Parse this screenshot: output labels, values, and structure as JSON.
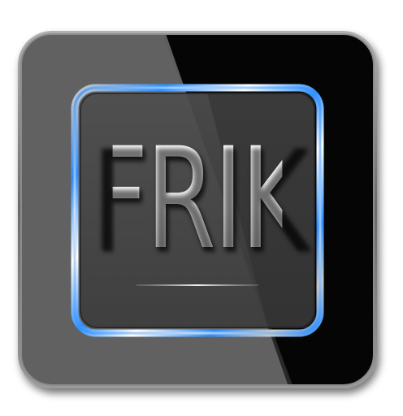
{
  "logo": {
    "text": "FRIK",
    "name": "frik-app-icon"
  },
  "colors": {
    "background": "#ffffff",
    "tile_left": "#5a5a5a",
    "tile_right": "#050505",
    "frame_blue": "#2e8fff",
    "frame_silver": "#e6e6e6",
    "inner_panel": "#4a4a4a",
    "underline": "#d9d9d9",
    "text": "#f4f4f4"
  }
}
